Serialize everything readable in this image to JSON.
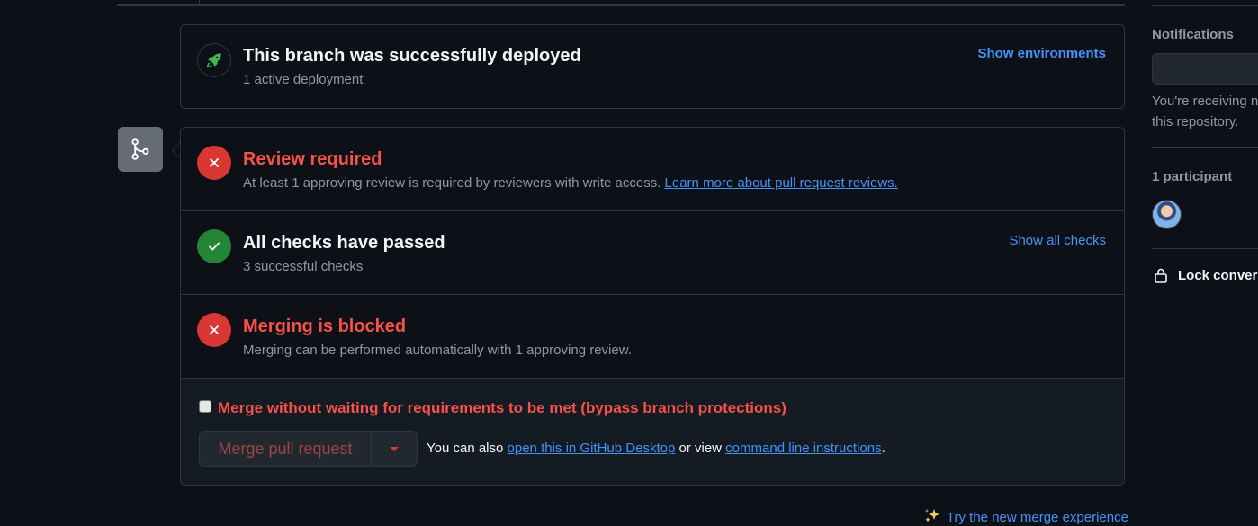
{
  "deployment": {
    "title": "This branch was successfully deployed",
    "subtitle": "1 active deployment",
    "show_environments": "Show environments"
  },
  "review": {
    "title": "Review required",
    "description": "At least 1 approving review is required by reviewers with write access.",
    "link": "Learn more about pull request reviews."
  },
  "checks": {
    "title": "All checks have passed",
    "subtitle": "3 successful checks",
    "show_all": "Show all checks"
  },
  "blocked": {
    "title": "Merging is blocked",
    "subtitle": "Merging can be performed automatically with 1 approving review."
  },
  "merge": {
    "bypass_label": "Merge without waiting for requirements to be met (bypass branch protections)",
    "button_label": "Merge pull request",
    "also_prefix": "You can also",
    "desktop_link": "open this in GitHub Desktop",
    "or_view": "or view",
    "cli_link": "command line instructions",
    "period": "."
  },
  "try_new": "Try the new merge experience",
  "sidebar": {
    "notifications_title": "Notifications",
    "notifications_text_1": "You're receiving no",
    "notifications_text_2": "this repository.",
    "participants_title": "1 participant",
    "lock_label": "Lock conversa"
  },
  "colors": {
    "background": "#0d1117",
    "danger": "#f85149",
    "success": "#238636",
    "link": "#4493f8"
  }
}
